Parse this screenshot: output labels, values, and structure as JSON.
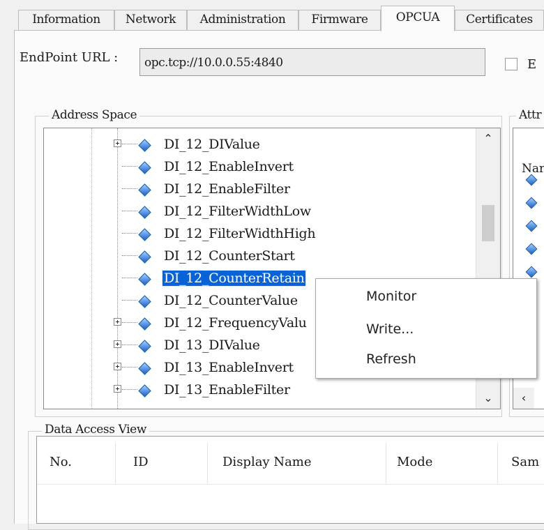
{
  "tabs": [
    "Information",
    "Network",
    "Administration",
    "Firmware",
    "OPCUA",
    "Certificates"
  ],
  "active_tab": "OPCUA",
  "endpoint": {
    "label": "EndPoint URL :",
    "value": "opc.tcp://10.0.0.55:4840",
    "checkbox_label": "E"
  },
  "address_space": {
    "title": "Address Space",
    "items": [
      {
        "label": "DI_12_DIValue",
        "expandable": true
      },
      {
        "label": "DI_12_EnableInvert",
        "expandable": false
      },
      {
        "label": "DI_12_EnableFilter",
        "expandable": false
      },
      {
        "label": "DI_12_FilterWidthLow",
        "expandable": false
      },
      {
        "label": "DI_12_FilterWidthHigh",
        "expandable": false
      },
      {
        "label": "DI_12_CounterStart",
        "expandable": false
      },
      {
        "label": "DI_12_CounterRetain",
        "expandable": false,
        "selected": true
      },
      {
        "label": "DI_12_CounterValue",
        "expandable": false
      },
      {
        "label": "DI_12_FrequencyValu",
        "expandable": true
      },
      {
        "label": "DI_13_DIValue",
        "expandable": true
      },
      {
        "label": "DI_13_EnableInvert",
        "expandable": true
      },
      {
        "label": "DI_13_EnableFilter",
        "expandable": true
      }
    ]
  },
  "attributes": {
    "title": "Attr",
    "column": "Nar"
  },
  "context_menu": [
    "Monitor",
    "Write...",
    "Refresh"
  ],
  "data_access_view": {
    "title": "Data Access View",
    "columns": [
      "No.",
      "ID",
      "Display Name",
      "Mode",
      "Sam"
    ]
  },
  "icons": {
    "node": "variable-node-icon",
    "expander": "plus-expander-icon"
  }
}
